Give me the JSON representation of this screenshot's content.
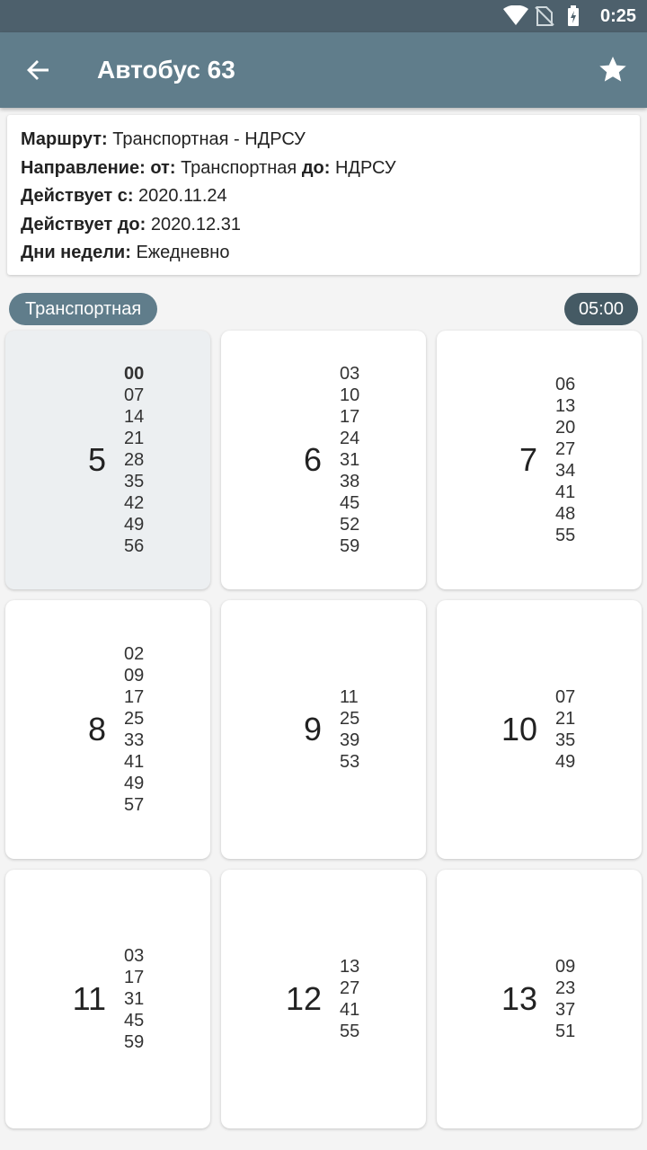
{
  "status_bar": {
    "time": "0:25",
    "icons": [
      "wifi-icon",
      "no-sim-icon",
      "battery-charging-icon"
    ]
  },
  "toolbar": {
    "title": "Автобус 63",
    "back_icon": "arrow-back-icon",
    "star_icon": "star-icon"
  },
  "info": {
    "route_label": "Маршрут:",
    "route_value": "Транспортная - НДРСУ",
    "direction_label": "Направление:",
    "from_label": "от:",
    "from_value": "Транспортная",
    "to_label": "до:",
    "to_value": "НДРСУ",
    "valid_from_label": "Действует с:",
    "valid_from_value": "2020.11.24",
    "valid_to_label": "Действует до:",
    "valid_to_value": "2020.12.31",
    "days_label": "Дни недели:",
    "days_value": "Ежедневно"
  },
  "stop_chip": "Транспортная",
  "time_chip": "05:00",
  "schedule": [
    {
      "hour": "5",
      "minutes": [
        "00",
        "07",
        "14",
        "21",
        "28",
        "35",
        "42",
        "49",
        "56"
      ],
      "current": true
    },
    {
      "hour": "6",
      "minutes": [
        "03",
        "10",
        "17",
        "24",
        "31",
        "38",
        "45",
        "52",
        "59"
      ]
    },
    {
      "hour": "7",
      "minutes": [
        "06",
        "13",
        "20",
        "27",
        "34",
        "41",
        "48",
        "55"
      ]
    },
    {
      "hour": "8",
      "minutes": [
        "02",
        "09",
        "17",
        "25",
        "33",
        "41",
        "49",
        "57"
      ]
    },
    {
      "hour": "9",
      "minutes": [
        "11",
        "25",
        "39",
        "53"
      ]
    },
    {
      "hour": "10",
      "minutes": [
        "07",
        "21",
        "35",
        "49"
      ]
    },
    {
      "hour": "11",
      "minutes": [
        "03",
        "17",
        "31",
        "45",
        "59"
      ]
    },
    {
      "hour": "12",
      "minutes": [
        "13",
        "27",
        "41",
        "55"
      ]
    },
    {
      "hour": "13",
      "minutes": [
        "09",
        "23",
        "37",
        "51"
      ]
    }
  ],
  "colors": {
    "toolbar": "#607d8b",
    "status_bar": "#4d606c",
    "time_chip": "#455a64",
    "current_card": "#eceff1"
  }
}
